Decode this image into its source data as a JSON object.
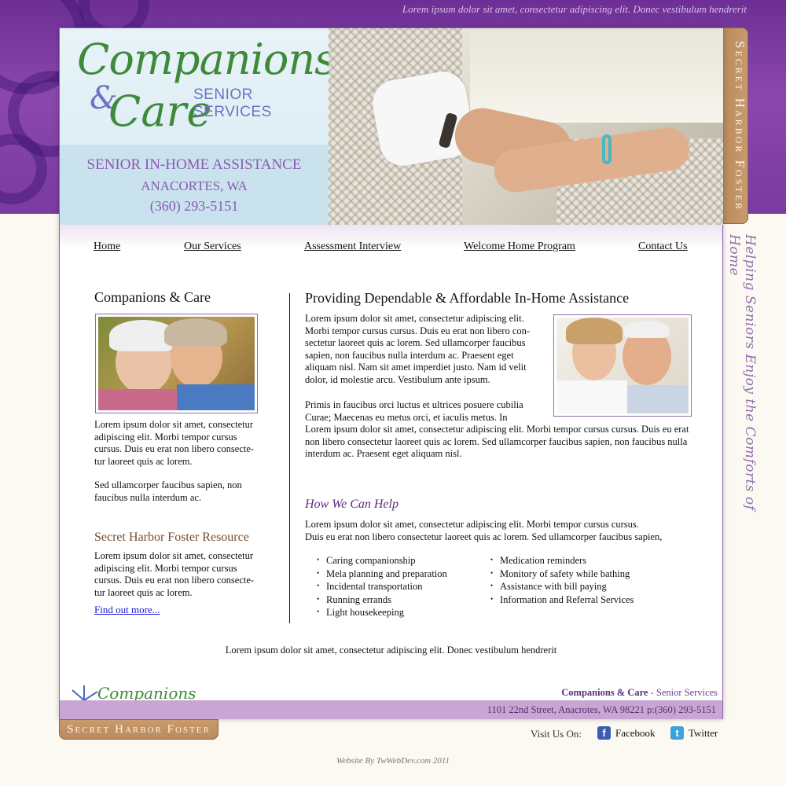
{
  "top_tagline": "Lorem ipsum dolor sit amet, consectetur adipiscing elit. Donec vestibulum hendrerit",
  "logo": {
    "word1": "Companions",
    "amp": "&",
    "word2": "Care",
    "subtitle": "SENIOR SERVICES"
  },
  "header": {
    "line1": "SENIOR IN-HOME ASSISTANCE",
    "line2": "ANACORTES, WA",
    "phone": "(360) 293-5151"
  },
  "side_tab": "Secret Harbor Foster",
  "side_script": "Helping Seniors Enjoy the Comforts of Home",
  "nav": [
    {
      "label": "Home"
    },
    {
      "label": "Our Services"
    },
    {
      "label": "Assessment Interview"
    },
    {
      "label": "Welcome Home Program"
    },
    {
      "label": "Contact Us"
    }
  ],
  "left": {
    "heading": "Companions & Care",
    "para1": "Lorem ipsum dolor sit amet, consectetur adipiscing elit. Morbi tempor cursus cursus. Duis eu erat non libero consecte-tur laoreet quis ac lorem.",
    "para2": "Sed ullamcorper faucibus sapien, non faucibus nulla interdum ac.",
    "resource_heading": "Secret Harbor Foster Resource",
    "resource_para": "Lorem ipsum dolor sit amet, consectetur adipiscing elit. Morbi tempor cursus cursus. Duis eu erat non libero consecte-tur laoreet quis ac lorem.",
    "find_more": "Find out more..."
  },
  "main": {
    "heading": "Providing Dependable & Affordable In-Home Assistance",
    "para1": "Lorem ipsum dolor sit amet, consectetur adipiscing elit. Morbi tempor cursus cursus. Duis eu erat non libero con-sectetur laoreet quis ac lorem.  Sed ullamcorper faucibus sapien, non faucibus nulla interdum ac. Praesent eget aliquam nisl. Nam sit amet imperdiet justo. Nam id velit dolor, id molestie arcu. Vestibulum ante ipsum.",
    "para2a": "Primis in faucibus orci luctus et ultrices posuere cubilia Curae; Maecenas eu metus orci, et iaculis metus. In",
    "para2b": "Lorem ipsum dolor sit amet, consectetur adipiscing elit. Morbi tempor cursus cursus. Duis eu erat non libero consectetur laoreet quis ac lorem.  Sed ullamcorper faucibus sapien, non faucibus nulla interdum ac. Praesent eget aliquam nisl.",
    "help_heading": "How We Can Help",
    "help_line1": "Lorem ipsum dolor sit amet, consectetur adipiscing elit. Morbi tempor cursus cursus.",
    "help_line2": "Duis eu erat non libero consectetur laoreet quis ac lorem.  Sed ullamcorper faucibus sapien,",
    "services_left": [
      "Caring companionship",
      "Mela planning and preparation",
      "Incidental transportation",
      "Running errands",
      "Light housekeeping"
    ],
    "services_right": [
      "Medication reminders",
      "Monitory of safety while bathing",
      "Assistance with bill paying",
      "Information and Referral Services"
    ]
  },
  "footer": {
    "line": "Lorem ipsum dolor sit amet, consectetur adipiscing elit. Donec vestibulum hendrerit",
    "company_bold": "Companions & Care",
    "company_rest": " - Senior Services",
    "address": "1101 22nd Street,  Anacrotes, WA 98221    p:(360) 293-5151",
    "bottom_tab": "Secret Harbor Foster",
    "visit": "Visit Us On:",
    "facebook": "Facebook",
    "twitter": "Twitter",
    "credit": "Website By TwWebDev.com 2011"
  },
  "colors": {
    "purple_band": "#7a3aa0",
    "header_blue": "#c9e2ee",
    "tab_brown": "#b98a5c",
    "footer_bar": "#c8a6d4",
    "facebook": "#3b5fb0",
    "twitter": "#3aa3dc"
  }
}
